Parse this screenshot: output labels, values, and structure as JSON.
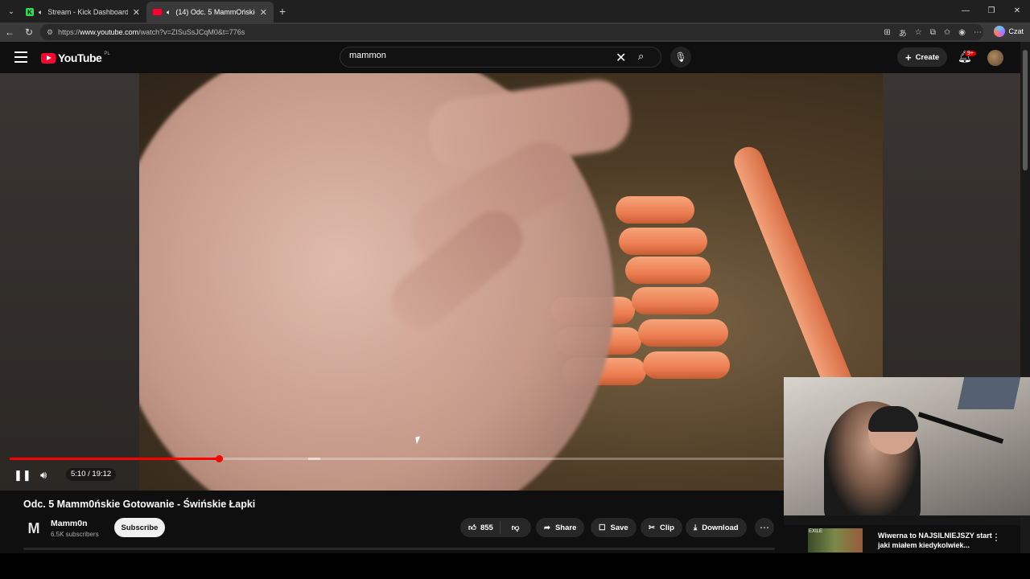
{
  "browser": {
    "tabs": [
      {
        "title": "Stream - Kick Dashboard",
        "favicon": "kick-icon"
      },
      {
        "title": "(14) Odc. 5 MammOńskie Got",
        "favicon": "youtube-icon",
        "audio": true
      }
    ],
    "url_prefix": "https://",
    "url_domain": "www.youtube.com",
    "url_path": "/watch?v=ZISuSsJCqM0&t=776s",
    "copilot_label": "Czat"
  },
  "youtube": {
    "logo_text": "YouTube",
    "country_code": "PL",
    "search_value": "mammon",
    "create_label": "Create",
    "notification_count": "9+"
  },
  "player": {
    "time_label": "5:10 / 19:12",
    "progress_fraction": 0.27,
    "buffer_start_fraction": 0.386
  },
  "video": {
    "title": "Odc. 5 Mamm0ńskie Gotowanie - Świńskie Łapki",
    "channel_initial": "M",
    "channel_name": "Mamm0n",
    "subscribers": "6.5K subscribers",
    "subscribe_label": "Subscribe",
    "likes": "855",
    "share_label": "Share",
    "save_label": "Save",
    "clip_label": "Clip",
    "download_label": "Download"
  },
  "recommendation": {
    "title": "Wiwerna to NAJSILNIEJSZY start jaki miałem kiedykolwiek...",
    "thumb_text": "EXILE"
  },
  "colors": {
    "accent": "#ff0000",
    "youtube_red": "#ff0033",
    "background": "#0f0f0f"
  }
}
